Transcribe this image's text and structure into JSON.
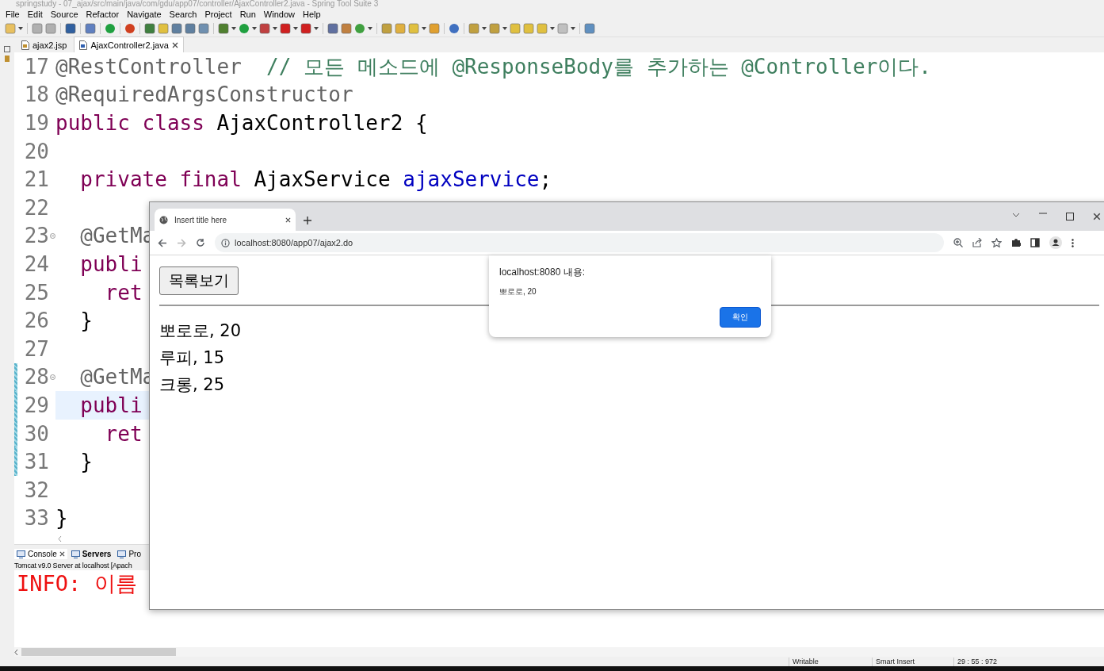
{
  "window": {
    "title": "springstudy - 07_ajax/src/main/java/com/gdu/app07/controller/AjaxController2.java - Spring Tool Suite 3"
  },
  "menu": [
    "File",
    "Edit",
    "Source",
    "Refactor",
    "Navigate",
    "Search",
    "Project",
    "Run",
    "Window",
    "Help"
  ],
  "editor_tabs": [
    {
      "label": "ajax2.jsp",
      "selected": false
    },
    {
      "label": "AjaxController2.java",
      "selected": true
    }
  ],
  "editor": {
    "lines": [
      {
        "number": "17",
        "current": false,
        "changed": false,
        "foldable": false,
        "tokens": [
          {
            "kind": "annotation",
            "text": "@RestController"
          },
          {
            "kind": "comment",
            "text": "  // 모든 메소드에 @ResponseBody를 추가하는 @Controller이다."
          }
        ]
      },
      {
        "number": "18",
        "current": false,
        "changed": false,
        "foldable": false,
        "tokens": [
          {
            "kind": "annotation",
            "text": "@RequiredArgsConstructor"
          }
        ]
      },
      {
        "number": "19",
        "current": false,
        "changed": false,
        "foldable": false,
        "tokens": [
          {
            "kind": "keyword",
            "text": "public class "
          },
          {
            "kind": "plain",
            "text": "AjaxController2 {"
          }
        ]
      },
      {
        "number": "20",
        "current": false,
        "changed": false,
        "foldable": false
      },
      {
        "number": "21",
        "current": false,
        "changed": false,
        "foldable": false,
        "tokens": [
          {
            "kind": "keyword",
            "text": "  private final "
          },
          {
            "kind": "plain",
            "text": "AjaxService "
          },
          {
            "kind": "field",
            "text": "ajaxService"
          },
          {
            "kind": "plain",
            "text": ";"
          }
        ]
      },
      {
        "number": "22",
        "current": false,
        "changed": false,
        "foldable": false
      },
      {
        "number": "23",
        "current": false,
        "changed": false,
        "foldable": true,
        "tokens": [
          {
            "kind": "annotation",
            "text": "  @GetMa"
          }
        ]
      },
      {
        "number": "24",
        "current": false,
        "changed": false,
        "foldable": false,
        "tokens": [
          {
            "kind": "keyword",
            "text": "  publi"
          }
        ]
      },
      {
        "number": "25",
        "current": false,
        "changed": false,
        "foldable": false,
        "tokens": [
          {
            "kind": "keyword",
            "text": "    ret"
          }
        ]
      },
      {
        "number": "26",
        "current": false,
        "changed": false,
        "foldable": false,
        "tokens": [
          {
            "kind": "plain",
            "text": "  }"
          }
        ]
      },
      {
        "number": "27",
        "current": false,
        "changed": false,
        "foldable": false
      },
      {
        "number": "28",
        "current": false,
        "changed": true,
        "foldable": true,
        "tokens": [
          {
            "kind": "annotation",
            "text": "  @GetMa"
          }
        ]
      },
      {
        "number": "29",
        "current": true,
        "changed": true,
        "foldable": false,
        "tokens": [
          {
            "kind": "keyword",
            "text": "  publi"
          }
        ]
      },
      {
        "number": "30",
        "current": false,
        "changed": true,
        "foldable": false,
        "tokens": [
          {
            "kind": "keyword",
            "text": "    ret"
          }
        ]
      },
      {
        "number": "31",
        "current": false,
        "changed": true,
        "foldable": false,
        "tokens": [
          {
            "kind": "plain",
            "text": "  }"
          }
        ]
      },
      {
        "number": "32",
        "current": false,
        "changed": false,
        "foldable": false
      },
      {
        "number": "33",
        "current": false,
        "changed": false,
        "foldable": false,
        "tokens": [
          {
            "kind": "plain",
            "text": "}"
          }
        ]
      }
    ]
  },
  "console": {
    "tabs": [
      {
        "label": "Console",
        "selected": true,
        "emphasized": false
      },
      {
        "label": "Servers",
        "selected": false,
        "emphasized": true
      },
      {
        "label": "Pro",
        "selected": false,
        "emphasized": false
      }
    ],
    "server_label": "Tomcat v9.0 Server at localhost [Apach",
    "output": [
      "INFO: 이름"
    ]
  },
  "status_bar": [
    "Writable",
    "Smart Insert",
    "29 : 55 : 972"
  ],
  "browser": {
    "tab_title": "Insert title here",
    "url": "localhost:8080/app07/ajax2.do",
    "page": {
      "button": "목록보기",
      "items": [
        "뽀로로, 20",
        "루피, 15",
        "크롱, 25"
      ]
    },
    "alert": {
      "title": "localhost:8080 내용:",
      "message": "뽀로로, 20",
      "ok": "확인"
    }
  }
}
